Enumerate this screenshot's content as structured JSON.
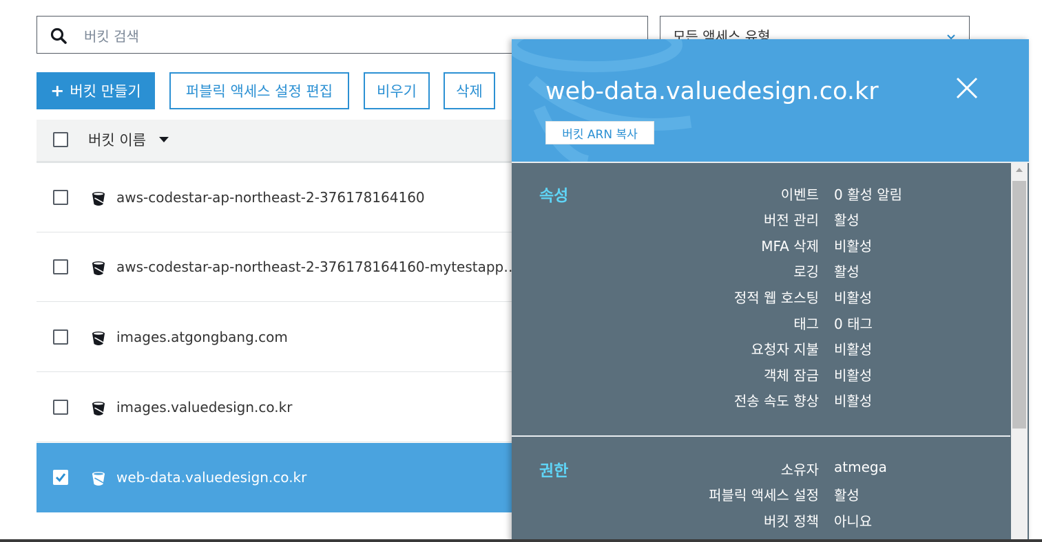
{
  "search": {
    "placeholder": "버킷 검색"
  },
  "filter": {
    "selected": "모든 액세스 유형"
  },
  "toolbar": {
    "create_label": "버킷 만들기",
    "public_access_label": "퍼블릭 액세스 설정 편집",
    "empty_label": "비우기",
    "delete_label": "삭제"
  },
  "table": {
    "column_header": "버킷 이름",
    "rows": [
      {
        "name": "aws-codestar-ap-northeast-2-376178164160",
        "checked": false
      },
      {
        "name": "aws-codestar-ap-northeast-2-376178164160-mytestapp…",
        "checked": false
      },
      {
        "name": "images.atgongbang.com",
        "checked": false
      },
      {
        "name": "images.valuedesign.co.kr",
        "checked": false
      },
      {
        "name": "web-data.valuedesign.co.kr",
        "checked": true
      }
    ]
  },
  "panel": {
    "title": "web-data.valuedesign.co.kr",
    "copy_arn_label": "버킷 ARN 복사",
    "properties": {
      "heading": "속성",
      "items": [
        {
          "label": "이벤트",
          "value": "0 활성 알림"
        },
        {
          "label": "버전 관리",
          "value": "활성"
        },
        {
          "label": "MFA 삭제",
          "value": "비활성"
        },
        {
          "label": "로깅",
          "value": "활성"
        },
        {
          "label": "정적 웹 호스팅",
          "value": "비활성"
        },
        {
          "label": "태그",
          "value": "0 태그"
        },
        {
          "label": "요청자 지불",
          "value": "비활성"
        },
        {
          "label": "객체 잠금",
          "value": "비활성"
        },
        {
          "label": "전송 속도 향상",
          "value": "비활성"
        }
      ]
    },
    "permissions": {
      "heading": "권한",
      "items": [
        {
          "label": "소유자",
          "value": "atmega"
        },
        {
          "label": "퍼블릭 액세스 설정",
          "value": "활성"
        },
        {
          "label": "버킷 정책",
          "value": "아니요"
        }
      ]
    }
  },
  "colors": {
    "accent": "#2b90d3",
    "selected_row": "#4aa3df",
    "panel_body": "#5b6f7c",
    "section_heading": "#5fd4f6"
  }
}
